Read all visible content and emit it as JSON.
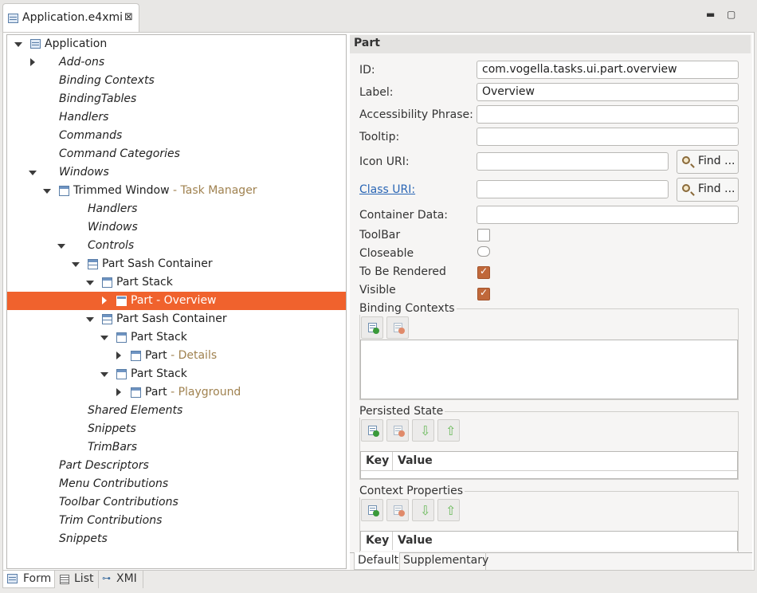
{
  "editor_tab": {
    "title": "Application.e4xmi",
    "close_glyph": "⊠"
  },
  "window_controls": {
    "minimize": "▬",
    "maximize": "▢"
  },
  "tree": [
    {
      "label": "Application",
      "suffix": "",
      "italic": false,
      "icon": "application-icon",
      "expander": "expanded"
    },
    {
      "label": "Add-ons",
      "suffix": "",
      "italic": true,
      "icon": "",
      "expander": "collapsed"
    },
    {
      "label": "Binding Contexts",
      "suffix": "",
      "italic": true,
      "icon": "",
      "expander": ""
    },
    {
      "label": "BindingTables",
      "suffix": "",
      "italic": true,
      "icon": "",
      "expander": ""
    },
    {
      "label": "Handlers",
      "suffix": "",
      "italic": true,
      "icon": "",
      "expander": ""
    },
    {
      "label": "Commands",
      "suffix": "",
      "italic": true,
      "icon": "",
      "expander": ""
    },
    {
      "label": "Command Categories",
      "suffix": "",
      "italic": true,
      "icon": "",
      "expander": ""
    },
    {
      "label": "Windows",
      "suffix": "",
      "italic": true,
      "icon": "",
      "expander": "expanded"
    },
    {
      "label": "Trimmed Window",
      "suffix": " - Task Manager",
      "italic": false,
      "icon": "window-icon",
      "expander": "expanded"
    },
    {
      "label": "Handlers",
      "suffix": "",
      "italic": true,
      "icon": "",
      "expander": ""
    },
    {
      "label": "Windows",
      "suffix": "",
      "italic": true,
      "icon": "",
      "expander": ""
    },
    {
      "label": "Controls",
      "suffix": "",
      "italic": true,
      "icon": "",
      "expander": "expanded"
    },
    {
      "label": "Part Sash Container",
      "suffix": "",
      "italic": false,
      "icon": "sash-container-icon",
      "expander": "expanded"
    },
    {
      "label": "Part Stack",
      "suffix": "",
      "italic": false,
      "icon": "window-icon",
      "expander": "expanded"
    },
    {
      "label": "Part",
      "suffix": " - Overview",
      "italic": false,
      "icon": "window-icon",
      "expander": "collapsed",
      "selected": true
    },
    {
      "label": "Part Sash Container",
      "suffix": "",
      "italic": false,
      "icon": "sash-container-icon",
      "expander": "expanded"
    },
    {
      "label": "Part Stack",
      "suffix": "",
      "italic": false,
      "icon": "window-icon",
      "expander": "expanded"
    },
    {
      "label": "Part",
      "suffix": " - Details",
      "italic": false,
      "icon": "window-icon",
      "expander": "collapsed"
    },
    {
      "label": "Part Stack",
      "suffix": "",
      "italic": false,
      "icon": "window-icon",
      "expander": "expanded"
    },
    {
      "label": "Part",
      "suffix": " - Playground",
      "italic": false,
      "icon": "window-icon",
      "expander": "collapsed"
    },
    {
      "label": "Shared Elements",
      "suffix": "",
      "italic": true,
      "icon": "",
      "expander": ""
    },
    {
      "label": "Snippets",
      "suffix": "",
      "italic": true,
      "icon": "",
      "expander": ""
    },
    {
      "label": "TrimBars",
      "suffix": "",
      "italic": true,
      "icon": "",
      "expander": ""
    },
    {
      "label": "Part Descriptors",
      "suffix": "",
      "italic": true,
      "icon": "",
      "expander": ""
    },
    {
      "label": "Menu Contributions",
      "suffix": "",
      "italic": true,
      "icon": "",
      "expander": ""
    },
    {
      "label": "Toolbar Contributions",
      "suffix": "",
      "italic": true,
      "icon": "",
      "expander": ""
    },
    {
      "label": "Trim Contributions",
      "suffix": "",
      "italic": true,
      "icon": "",
      "expander": ""
    },
    {
      "label": "Snippets",
      "suffix": "",
      "italic": true,
      "icon": "",
      "expander": ""
    }
  ],
  "details": {
    "title": "Part",
    "id_label": "ID:",
    "id_value": "com.vogella.tasks.ui.part.overview",
    "label_label": "Label:",
    "label_value": "Overview",
    "accessibility_label": "Accessibility Phrase:",
    "accessibility_value": "",
    "tooltip_label": "Tooltip:",
    "tooltip_value": "",
    "icon_uri_label": "Icon URI:",
    "icon_uri_value": "",
    "class_uri_label": "Class URI:",
    "class_uri_value": "",
    "find_label": "Find ...",
    "container_data_label": "Container Data:",
    "container_data_value": "",
    "toolbar_label": "ToolBar",
    "toolbar_checked": false,
    "closeable_label": "Closeable",
    "closeable_checked": false,
    "rendered_label": "To Be Rendered",
    "rendered_checked": true,
    "visible_label": "Visible",
    "visible_checked": true,
    "binding_contexts_title": "Binding Contexts",
    "persisted_state_title": "Persisted State",
    "context_properties_title": "Context Properties",
    "key_header": "Key",
    "value_header": "Value",
    "arrow_down": "⇩",
    "arrow_up": "⇧"
  },
  "detail_tabs": [
    "Default",
    "Supplementary"
  ],
  "bottom_tabs": [
    "Form",
    "List",
    "XMI"
  ],
  "colors": {
    "selection": "#f0622d",
    "suffix": "#a08250",
    "link": "#2a66b5",
    "checked": "#c0683a"
  }
}
